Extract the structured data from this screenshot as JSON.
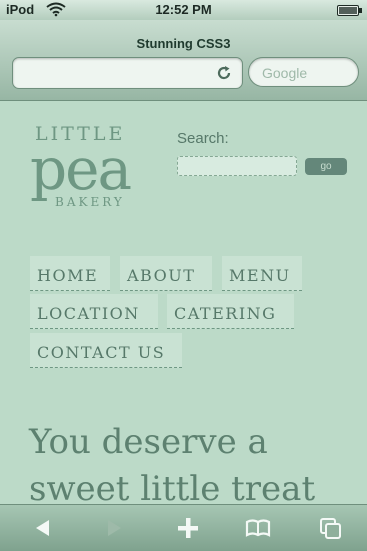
{
  "status_bar": {
    "carrier": "iPod",
    "time": "12:52 PM"
  },
  "browser": {
    "page_title": "Stunning CSS3",
    "url_value": "",
    "search_placeholder": "Google"
  },
  "page": {
    "logo": {
      "line1": "LITTLE",
      "line2": "pea",
      "line3": "BAKERY"
    },
    "search": {
      "label": "Search:",
      "value": "",
      "button_label": "go"
    },
    "nav": [
      {
        "label": "HOME"
      },
      {
        "label": "ABOUT"
      },
      {
        "label": "MENU"
      },
      {
        "label": "LOCATION"
      },
      {
        "label": "CATERING"
      },
      {
        "label": "CONTACT US"
      }
    ],
    "headline": "You deserve a sweet little treat"
  },
  "toolbar": {
    "icons": [
      "back-arrow-icon",
      "forward-arrow-icon",
      "add-icon",
      "bookmarks-icon",
      "pages-icon"
    ]
  },
  "colors": {
    "page_bg": "#bcdac8",
    "accent": "#6e9783",
    "nav_bg": "#c9e2d3"
  }
}
